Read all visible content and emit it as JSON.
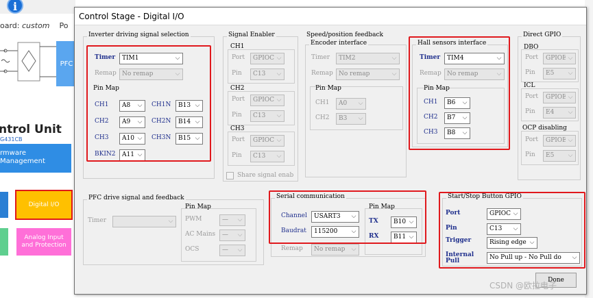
{
  "background": {
    "info_icon": "i",
    "board_label": "oard: ",
    "board_value": "custom",
    "po_text": "Po",
    "pfc_label": "PFC",
    "control_unit_title": "ntrol Unit",
    "control_unit_sub": "G431CB",
    "firmware_tile": "rmware\nManagement",
    "digital_io_tile": "Digital I/O",
    "analog_tile": "Analog Input\nand Protection",
    "colors": {
      "firmware": "#2f8de4",
      "digital_io": "#ffc000",
      "analog": "#ff6fd8",
      "green": "#5fcf8f"
    }
  },
  "dialog": {
    "title": "Control Stage - Digital I/O",
    "inverter": {
      "title": "Inverter driving signal selection",
      "timer_label": "Timer",
      "timer_value": "TIM1",
      "remap_label": "Remap",
      "remap_value": "No remap",
      "pinmap_title": "Pin Map",
      "pins": [
        {
          "label": "CH1",
          "value": "A8"
        },
        {
          "label": "CH2",
          "value": "A9"
        },
        {
          "label": "CH3",
          "value": "A10"
        },
        {
          "label": "BKIN2",
          "value": "A11"
        },
        {
          "label": "CH1N",
          "value": "B13"
        },
        {
          "label": "CH2N",
          "value": "B14"
        },
        {
          "label": "CH3N",
          "value": "B15"
        }
      ]
    },
    "signal_enabler": {
      "title": "Signal Enabler",
      "channels": [
        {
          "title": "CH1",
          "port_label": "Port",
          "port_value": "GPIOC",
          "pin_label": "Pin",
          "pin_value": "C13"
        },
        {
          "title": "CH2",
          "port_label": "Port",
          "port_value": "GPIOC",
          "pin_label": "Pin",
          "pin_value": "C13"
        },
        {
          "title": "CH3",
          "port_label": "Port",
          "port_value": "GPIOC",
          "pin_label": "Pin",
          "pin_value": "C13"
        }
      ],
      "share_label": "Share signal enab"
    },
    "speed": {
      "title": "Speed/position feedback",
      "encoder": {
        "title": "Encoder interface",
        "timer_label": "Timer",
        "timer_value": "TIM2",
        "remap_label": "Remap",
        "remap_value": "No remap",
        "pinmap_title": "Pin Map",
        "ch1_label": "CH1",
        "ch1_value": "A0",
        "ch2_label": "CH2",
        "ch2_value": "B3"
      },
      "hall": {
        "title": "Hall sensors interface",
        "timer_label": "Timer",
        "timer_value": "TIM4",
        "remap_label": "Remap",
        "remap_value": "No remap",
        "pinmap_title": "Pin Map",
        "ch1_label": "CH1",
        "ch1_value": "B6",
        "ch2_label": "CH2",
        "ch2_value": "B7",
        "ch3_label": "CH3",
        "ch3_value": "B8"
      }
    },
    "direct_gpio": {
      "title": "Direct GPIO",
      "dbo_title": "DBO",
      "dbo_port_label": "Port",
      "dbo_port_value": "GPIOE",
      "dbo_pin_label": "Pin",
      "dbo_pin_value": "E5",
      "icl_title": "ICL",
      "icl_port_label": "Port",
      "icl_port_value": "GPIOE",
      "icl_pin_label": "Pin",
      "icl_pin_value": "E4",
      "ocp_title": "OCP disabling",
      "ocp_port_label": "Port",
      "ocp_port_value": "GPIOE",
      "ocp_pin_label": "Pin",
      "ocp_pin_value": "E5"
    },
    "pfc": {
      "title": "PFC drive signal and feedback",
      "timer_label": "Timer",
      "timer_value": "",
      "pinmap_title": "Pin Map",
      "pwm_label": "PWM",
      "pwm_value": "—",
      "ac_label": "AC Mains",
      "ac_value": "—",
      "ocs_label": "OCS",
      "ocs_value": "—"
    },
    "serial": {
      "title": "Serial communication",
      "channel_label": "Channel",
      "channel_value": "USART3",
      "baud_label": "Baudrat",
      "baud_value": "115200",
      "remap_label": "Remap",
      "remap_value": "No remap",
      "pinmap_title": "Pin Map",
      "tx_label": "TX",
      "tx_value": "B10",
      "rx_label": "RX",
      "rx_value": "B11"
    },
    "startstop": {
      "title": "Start/Stop Button GPIO",
      "port_label": "Port",
      "port_value": "GPIOC",
      "pin_label": "Pin",
      "pin_value": "C13",
      "trigger_label": "Trigger",
      "trigger_value": "Rising edge",
      "internal_label": "Internal",
      "pull_label": "Pull",
      "pull_value": "No Pull up - No Pull do"
    },
    "done_label": "Done"
  },
  "watermark": "CSDN @欧拉电子"
}
